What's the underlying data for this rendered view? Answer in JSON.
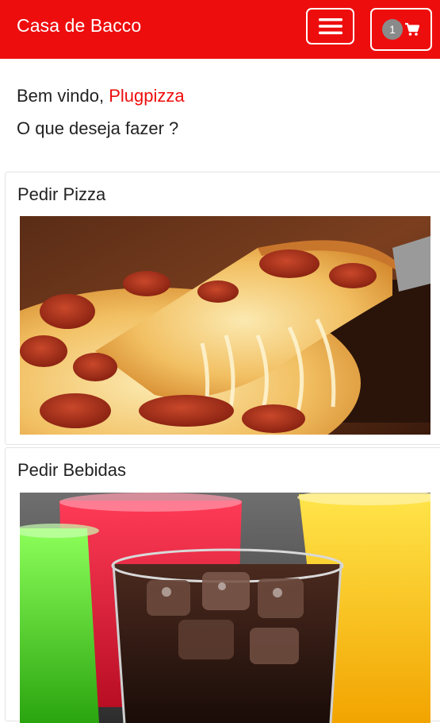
{
  "header": {
    "brand": "Casa de Bacco",
    "menu_icon": "hamburger-icon",
    "cart_icon": "shopping-cart-icon",
    "cart_count": "1",
    "accent_color": "#ee0d0d"
  },
  "welcome": {
    "greeting": "Bem vindo,",
    "username": "Plugpizza",
    "question": "O que deseja fazer ?"
  },
  "cards": [
    {
      "title": "Pedir Pizza",
      "image": "pizza-photo"
    },
    {
      "title": "Pedir Bebidas",
      "image": "drinks-photo"
    }
  ]
}
